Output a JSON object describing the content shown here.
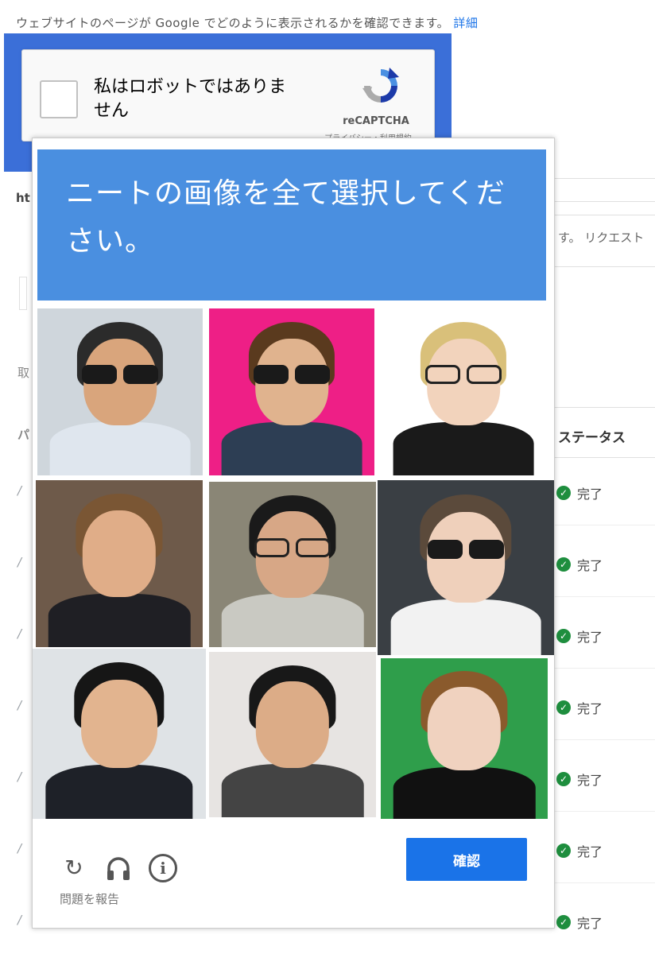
{
  "background": {
    "top_text": "ウェブサイトのページが Google でどのように表示されるかを確認できます。",
    "top_link": "詳細",
    "fragment_ht": "ht",
    "fragment_request": "す。 リクエスト",
    "fragment_side": "取",
    "fragment_pa": "パ",
    "status_header": "ステータス",
    "status_items": [
      "完了",
      "完了",
      "完了",
      "完了",
      "完了",
      "完了",
      "完了"
    ],
    "sidebar_mark": "/"
  },
  "recaptcha": {
    "label": "私はロボットではありません",
    "brand": "reCAPTCHA",
    "terms": "プライバシー・利用規約",
    "logo_icon": "recaptcha-logo-icon"
  },
  "challenge": {
    "title": "ニートの画像を全て選択してください。",
    "verify_label": "確認",
    "report_label": "問題を報告",
    "icons": [
      "reload-icon",
      "headphones-icon",
      "info-icon"
    ],
    "tiles": [
      {
        "bg": "#cfd6dc",
        "skin": "#d9a57c",
        "hair": "#2b2b2b",
        "clothes": "#dfe6ee",
        "glasses": "dark"
      },
      {
        "bg": "#ee1f86",
        "skin": "#e0b38e",
        "hair": "#5a3a1e",
        "clothes": "#2d3e54",
        "glasses": "dark"
      },
      {
        "bg": "#ffffff",
        "skin": "#f2d3bc",
        "hair": "#d9c07a",
        "clothes": "#1a1a1a",
        "glasses": "clear"
      },
      {
        "bg": "#6e5a4a",
        "skin": "#e0ad88",
        "hair": "#7a5634",
        "clothes": "#1f1f24",
        "glasses": "none"
      },
      {
        "bg": "#8a8676",
        "skin": "#d7a786",
        "hair": "#1a1a1a",
        "clothes": "#c9c9c2",
        "glasses": "clear"
      },
      {
        "bg": "#3a3f44",
        "skin": "#efd0bb",
        "hair": "#5b4a3b",
        "clothes": "#f2f2f2",
        "glasses": "dark"
      },
      {
        "bg": "#dfe3e6",
        "skin": "#e2b48f",
        "hair": "#161616",
        "clothes": "#1e2128",
        "glasses": "none"
      },
      {
        "bg": "#e7e4e2",
        "skin": "#dcac87",
        "hair": "#181818",
        "clothes": "#444",
        "glasses": "none"
      },
      {
        "bg": "#2f9e4b",
        "skin": "#f0d2bf",
        "hair": "#8a5a2c",
        "clothes": "#111",
        "glasses": "none"
      }
    ]
  },
  "colors": {
    "header_blue": "#4a8fe0",
    "verify_blue": "#1a73e8",
    "status_green": "#1e8e3e"
  }
}
